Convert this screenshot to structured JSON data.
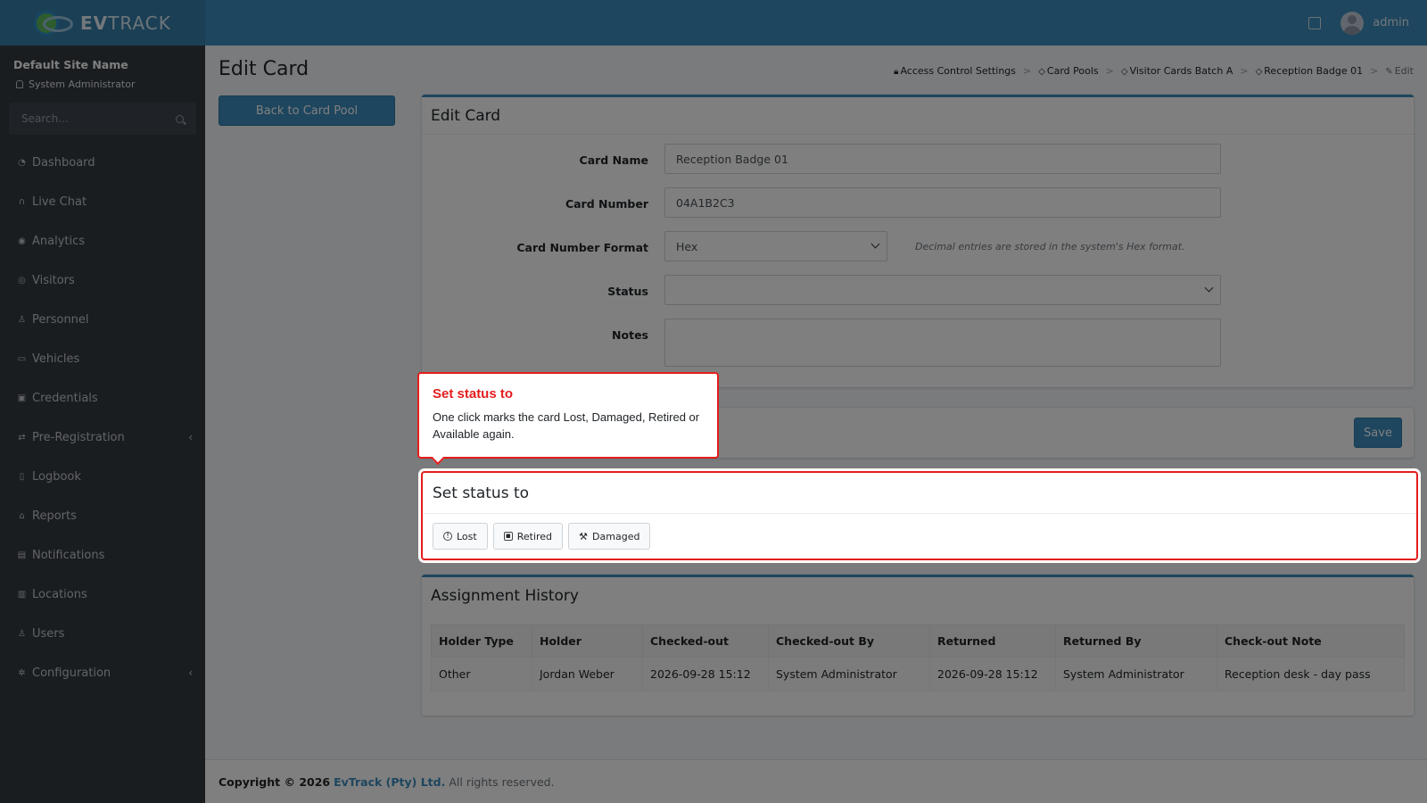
{
  "brand": {
    "name_bold": "EV",
    "name_rest": "TRACK"
  },
  "topbar": {
    "user": "admin"
  },
  "sidebar": {
    "site_name": "Default Site Name",
    "role": "System Administrator",
    "search_placeholder": "Search...",
    "items": [
      {
        "label": "Dashboard",
        "icon": "dashboard-icon"
      },
      {
        "label": "Live Chat",
        "icon": "headset-icon"
      },
      {
        "label": "Analytics",
        "icon": "analytics-icon"
      },
      {
        "label": "Visitors",
        "icon": "eye-icon"
      },
      {
        "label": "Personnel",
        "icon": "personnel-icon"
      },
      {
        "label": "Vehicles",
        "icon": "car-icon"
      },
      {
        "label": "Credentials",
        "icon": "credentials-icon"
      },
      {
        "label": "Pre-Registration",
        "icon": "exchange-icon"
      },
      {
        "label": "Logbook",
        "icon": "book-icon"
      },
      {
        "label": "Reports",
        "icon": "reports-icon"
      },
      {
        "label": "Notifications",
        "icon": "notifications-icon"
      },
      {
        "label": "Locations",
        "icon": "map-icon"
      },
      {
        "label": "Users",
        "icon": "users-icon"
      },
      {
        "label": "Configuration",
        "icon": "gear-icon"
      }
    ]
  },
  "page": {
    "title": "Edit Card",
    "back_button": "Back to Card Pool",
    "breadcrumb": [
      "Access Control Settings",
      "Card Pools",
      "Visitor Cards Batch A",
      "Reception Badge 01",
      "Edit"
    ]
  },
  "edit_card": {
    "heading": "Edit Card",
    "card_name_label": "Card Name",
    "card_name_value": "Reception Badge 01",
    "card_number_label": "Card Number",
    "card_number_value": "04A1B2C3",
    "format_label": "Card Number Format",
    "format_value": "Hex",
    "format_hint": "Decimal entries are stored in the system's Hex format.",
    "status_label": "Status",
    "status_value": "",
    "notes_label": "Notes",
    "notes_value": "",
    "save_button": "Save"
  },
  "set_status": {
    "heading": "Set status to",
    "buttons": [
      {
        "label": "Lost",
        "icon": "info-circle-icon"
      },
      {
        "label": "Retired",
        "icon": "archive-icon"
      },
      {
        "label": "Damaged",
        "icon": "wrench-icon"
      }
    ]
  },
  "tooltip": {
    "title": "Set status to",
    "body": "One click marks the card Lost, Damaged, Retired or Available again."
  },
  "history": {
    "heading": "Assignment History",
    "columns": [
      "Holder Type",
      "Holder",
      "Checked-out",
      "Checked-out By",
      "Returned",
      "Returned By",
      "Check-out Note"
    ],
    "rows": [
      [
        "Other",
        "Jordan Weber",
        "2026-09-28 15:12",
        "System Administrator",
        "2026-09-28 15:12",
        "System Administrator",
        "Reception desk - day pass"
      ]
    ]
  },
  "footer": {
    "copyright": "Copyright © 2026",
    "company": "EvTrack (Pty) Ltd.",
    "rights": "All rights reserved."
  },
  "colors": {
    "primary": "#3c8dbc",
    "sidebar": "#343a40",
    "highlight": "#e41d1d"
  }
}
